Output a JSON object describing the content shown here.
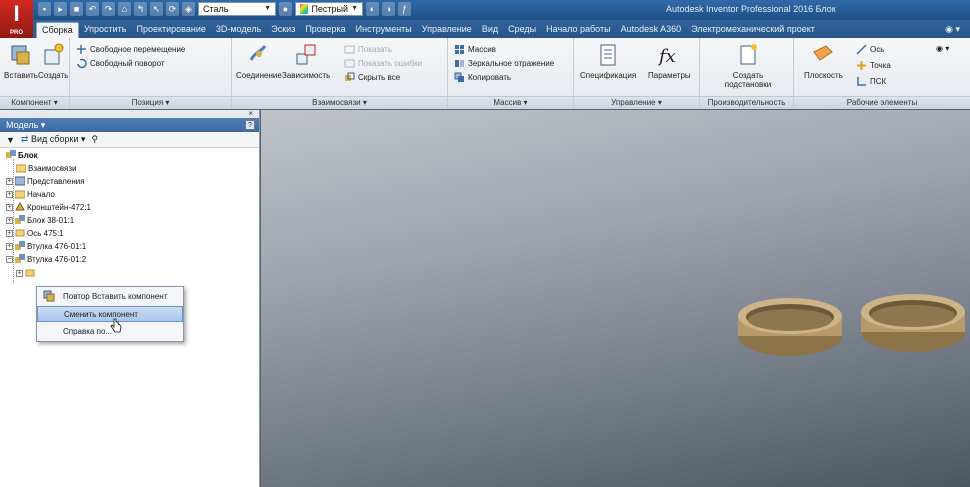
{
  "title_bar": {
    "app_logo": "I",
    "app_logo_sub": "PRO",
    "material": "Сталь",
    "appearance": "Пестрый",
    "window_title": "Autodesk Inventor Professional 2016   Блок"
  },
  "tabs": [
    "Сборка",
    "Упростить",
    "Проектирование",
    "3D-модель",
    "Эскиз",
    "Проверка",
    "Инструменты",
    "Управление",
    "Вид",
    "Среды",
    "Начало работы",
    "Autodesk A360",
    "Электромеханический проект"
  ],
  "ribbon": {
    "component": {
      "insert": "Вставить",
      "create": "Создать",
      "footer": "Компонент ▾"
    },
    "position": {
      "free_move": "Свободное перемещение",
      "free_rotate": "Свободный поворот",
      "footer": "Позиция ▾"
    },
    "relationships": {
      "joint": "Соединение",
      "constrain": "Зависимость",
      "show": "Показать",
      "show_sick": "Показать ошибки",
      "hide_all": "Скрыть все",
      "footer": "Взаимосвязи ▾"
    },
    "pattern": {
      "pattern": "Массив",
      "mirror": "Зеркальное отражение",
      "copy": "Копировать",
      "footer": "Массив ▾"
    },
    "manage": {
      "bom": "Спецификация",
      "parameters": "Параметры",
      "footer": "Управление ▾"
    },
    "productivity": {
      "substitute": "Создать подстановки",
      "footer": "Производительность"
    },
    "work_features": {
      "plane": "Плоскость",
      "axis": "Ось",
      "point": "Точка",
      "ucs": "ПСК",
      "footer": "Рабочие элементы"
    }
  },
  "browser": {
    "title": "Модель ▾",
    "view": "Вид сборки",
    "tree": [
      "Блок",
      "Взаимосвязи",
      "Представления",
      "Начало",
      "Кронштейн-472:1",
      "Блок 38-01:1",
      "Ось 475:1",
      "Втулка 476-01:1",
      "Втулка 476-01:2"
    ]
  },
  "context_menu": [
    "Повтор Вставить компонент",
    "Сменить компонент",
    "Справка по..."
  ],
  "colors": {
    "ribbon_accent": "#2f6aa8",
    "logo": "#c8261c",
    "ring": "#c2a77a"
  }
}
